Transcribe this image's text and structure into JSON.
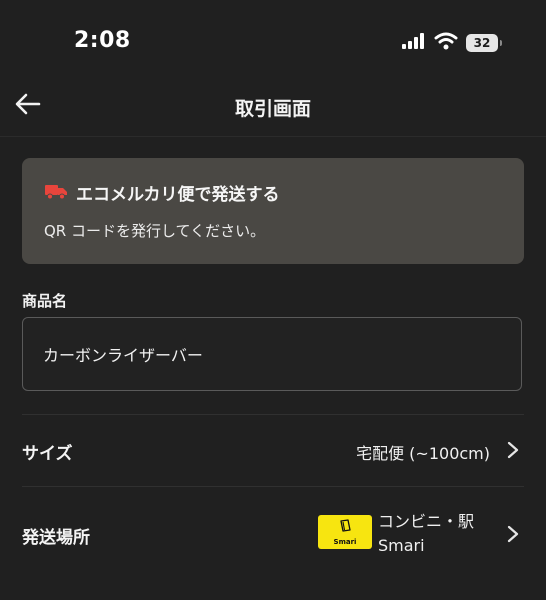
{
  "status_bar": {
    "time": "2:08",
    "battery": "32"
  },
  "nav": {
    "title": "取引画面"
  },
  "notice": {
    "title": "エコメルカリ便で発送する",
    "description": "QR コードを発行してください。",
    "icon": "truck-icon",
    "icon_color": "#e8453c"
  },
  "product": {
    "label": "商品名",
    "value": "カーボンライザーバー"
  },
  "size_row": {
    "label": "サイズ",
    "value": "宅配便 (~100cm)"
  },
  "shipping_row": {
    "label": "発送場所",
    "logo_text": "Smari",
    "line1": "コンビニ・駅",
    "line2": "Smari"
  },
  "colors": {
    "background": "#202020",
    "card": "#4a4844",
    "smari_yellow": "#f7e510"
  }
}
